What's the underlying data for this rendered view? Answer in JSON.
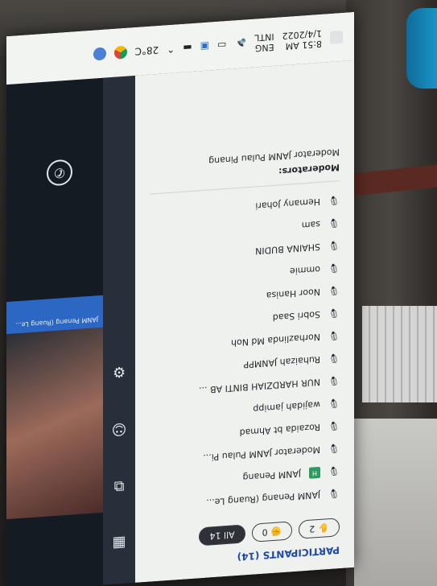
{
  "taskbar": {
    "temp": "28°C",
    "lang": "ENG",
    "lang2": "INTL",
    "time": "8:51 AM",
    "date": "1/4/2022"
  },
  "panel": {
    "header": "PARTICIPANTS (14)",
    "filters": [
      {
        "label": "2",
        "icon": "raised-hand-icon"
      },
      {
        "label": "0",
        "icon": "hand-icon"
      },
      {
        "label": "All 14",
        "icon": ""
      }
    ],
    "participants": [
      {
        "name": "JANM Penang (Ruang Le..."
      },
      {
        "name": "JANM Penang"
      },
      {
        "name": "Moderator JANM Pulau Pi..."
      },
      {
        "name": "Rozaida bt Ahmad"
      },
      {
        "name": "wajidah jamipp"
      },
      {
        "name": "NUR HARDZIAH BINTI AB ..."
      },
      {
        "name": "Ruhaizah JANMPP"
      },
      {
        "name": "Norhazlinda Md Noh"
      },
      {
        "name": "Sobri Saad"
      },
      {
        "name": "Noor Hanisa"
      },
      {
        "name": "ommie"
      },
      {
        "name": "SHAINA BUDIN"
      },
      {
        "name": "sam"
      },
      {
        "name": "Hemany Johari"
      }
    ],
    "moderators_label": "Moderators:",
    "moderator_name": "Moderator JANM Pulau Pinang"
  },
  "video": {
    "bar_text": "JANM Penang (Ruang Le..."
  }
}
